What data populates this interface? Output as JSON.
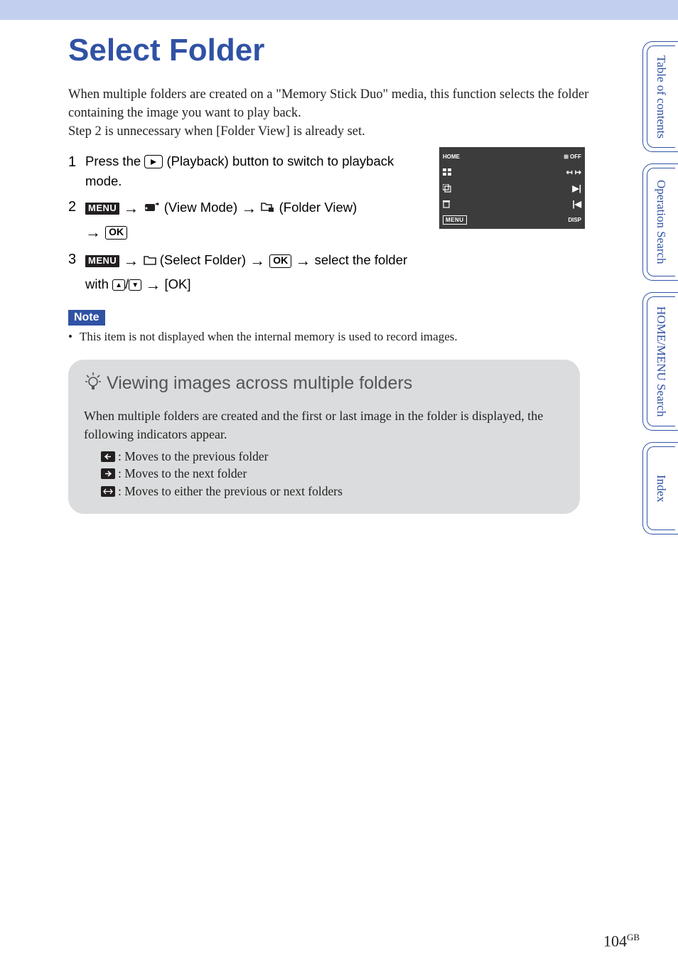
{
  "title": "Select Folder",
  "intro_l1": "When multiple folders are created on a \"Memory Stick Duo\" media, this function selects the folder containing the image you want to play back.",
  "intro_l2": "Step 2 is unnecessary when [Folder View] is already set.",
  "steps": {
    "s1_num": "1",
    "s1_a": "Press the ",
    "s1_b": " (Playback) button to switch to playback mode.",
    "s2_num": "2",
    "s2_menu": "MENU",
    "s2_view": " (View Mode) ",
    "s2_folder": " (Folder View) ",
    "s2_ok": "OK",
    "s3_num": "3",
    "s3_menu": "MENU",
    "s3_sel": " (Select Folder) ",
    "s3_ok": "OK",
    "s3_tail_a": " select the folder with ",
    "s3_tail_b": " [OK]"
  },
  "note_label": "Note",
  "note_text": "This item is not displayed when the internal memory is used to record images.",
  "tip": {
    "title": "Viewing images across multiple folders",
    "body": "When multiple folders are created and the first or last image in the folder is displayed, the following indicators appear.",
    "i1": ": Moves to the previous folder",
    "i2": ": Moves to the next folder",
    "i3": ": Moves to either the previous or next folders"
  },
  "tabs": {
    "t1": "Table of\ncontents",
    "t2": "Operation\nSearch",
    "t3": "HOME/MENU\nSearch",
    "t4": "Index"
  },
  "cam": {
    "home": "HOME",
    "off": "OFF",
    "menu": "MENU",
    "disp": "DISP"
  },
  "page_number": "104",
  "page_suffix": "GB"
}
